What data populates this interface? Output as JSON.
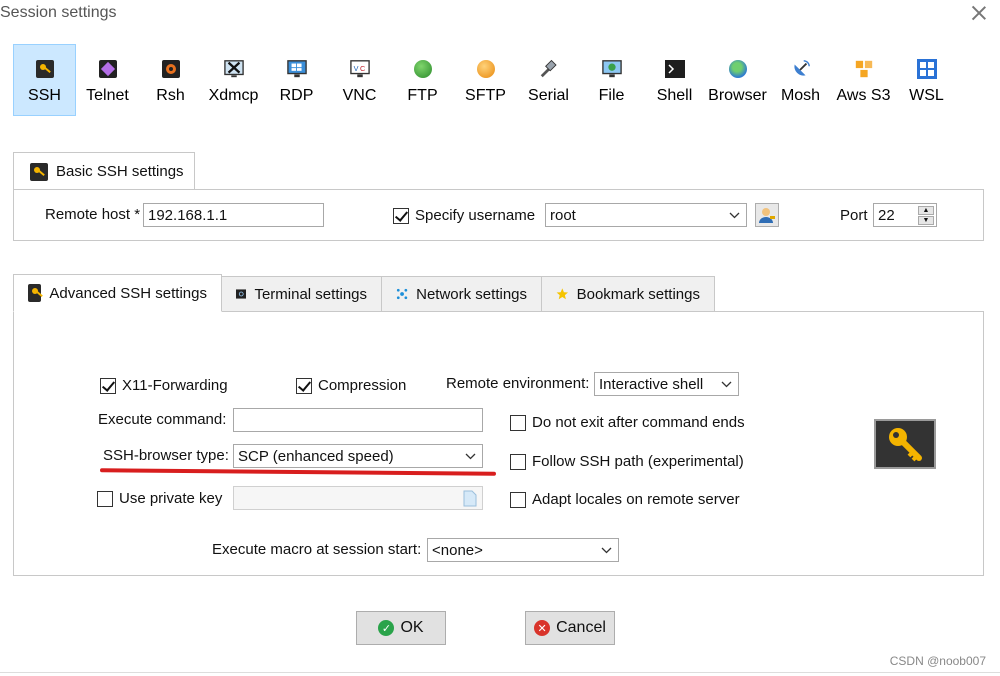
{
  "window": {
    "title": "Session settings"
  },
  "session_types": [
    {
      "label": "SSH",
      "icon": "key-icon",
      "selected": true
    },
    {
      "label": "Telnet",
      "icon": "telnet-icon"
    },
    {
      "label": "Rsh",
      "icon": "rsh-icon"
    },
    {
      "label": "Xdmcp",
      "icon": "xdmcp-icon"
    },
    {
      "label": "RDP",
      "icon": "rdp-icon"
    },
    {
      "label": "VNC",
      "icon": "vnc-icon"
    },
    {
      "label": "FTP",
      "icon": "ftp-icon"
    },
    {
      "label": "SFTP",
      "icon": "sftp-icon"
    },
    {
      "label": "Serial",
      "icon": "serial-icon"
    },
    {
      "label": "File",
      "icon": "file-icon"
    },
    {
      "label": "Shell",
      "icon": "shell-icon"
    },
    {
      "label": "Browser",
      "icon": "browser-icon"
    },
    {
      "label": "Mosh",
      "icon": "mosh-icon"
    },
    {
      "label": "Aws S3",
      "icon": "aws-s3-icon"
    },
    {
      "label": "WSL",
      "icon": "wsl-icon"
    }
  ],
  "basic": {
    "tab_label": "Basic SSH settings",
    "remote_host_label": "Remote host *",
    "remote_host_value": "192.168.1.1",
    "specify_username_label": "Specify username",
    "specify_username_checked": true,
    "username_value": "root",
    "port_label": "Port",
    "port_value": "22"
  },
  "tabs": [
    {
      "label": "Advanced SSH settings",
      "active": true
    },
    {
      "label": "Terminal settings"
    },
    {
      "label": "Network settings"
    },
    {
      "label": "Bookmark settings"
    }
  ],
  "advanced": {
    "x11_label": "X11-Forwarding",
    "x11_checked": true,
    "compression_label": "Compression",
    "compression_checked": true,
    "remote_env_label": "Remote environment:",
    "remote_env_value": "Interactive shell",
    "execute_command_label": "Execute command:",
    "execute_command_value": "",
    "do_not_exit_label": "Do not exit after command ends",
    "do_not_exit_checked": false,
    "browser_type_label": "SSH-browser type:",
    "browser_type_value": "SCP (enhanced speed)",
    "follow_path_label": "Follow SSH path (experimental)",
    "follow_path_checked": false,
    "private_key_label": "Use private key",
    "private_key_checked": false,
    "adapt_locales_label": "Adapt locales on remote server",
    "adapt_locales_checked": false,
    "macro_label": "Execute macro at session start:",
    "macro_value": "<none>"
  },
  "buttons": {
    "ok": "OK",
    "cancel": "Cancel"
  },
  "watermark": "CSDN @noob007",
  "colors": {
    "selected_bg": "#cce8ff",
    "annotation_red": "#d81e1e",
    "ok_green": "#2aa34a",
    "cancel_red": "#d9342b"
  }
}
